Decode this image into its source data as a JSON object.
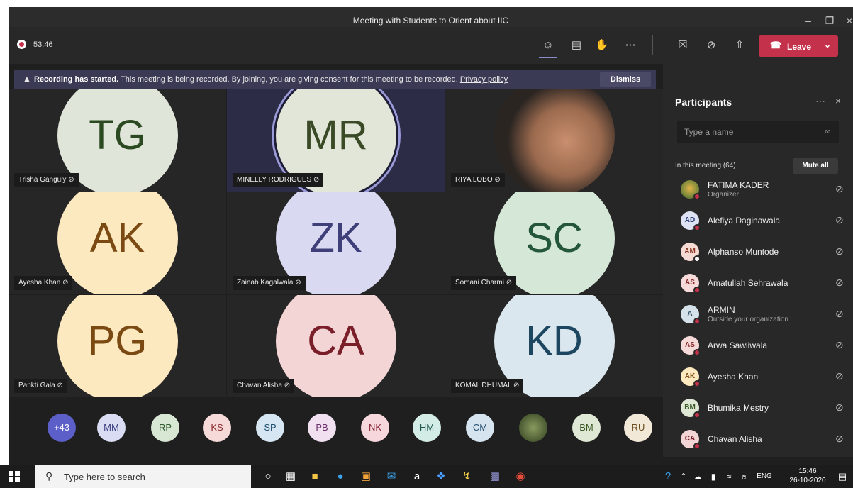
{
  "window": {
    "title": "Meeting with Students to Orient about IIC",
    "minimize": "–",
    "maximize": "❐",
    "close": "×"
  },
  "toolbar": {
    "timer": "53:46",
    "leave_label": "Leave"
  },
  "banner": {
    "bold": "Recording has started.",
    "text": "This meeting is being recorded. By joining, you are giving consent for this meeting to be recorded.",
    "link": "Privacy policy",
    "dismiss": "Dismiss"
  },
  "tiles": [
    {
      "initials": "TG",
      "name": "Trisha Ganguly",
      "bg": "#dfe6d9",
      "fg": "#2c4a22"
    },
    {
      "initials": "MR",
      "name": "MINELLY RODRIGUES",
      "bg": "#e1e6d8",
      "fg": "#3b4a26"
    },
    {
      "initials": "",
      "name": "RIYA LOBO",
      "bg": "#3d3735",
      "fg": "#ffffff"
    },
    {
      "initials": "AK",
      "name": "Ayesha Khan",
      "bg": "#fde9c0",
      "fg": "#7a4a12"
    },
    {
      "initials": "ZK",
      "name": "Zainab Kagalwala",
      "bg": "#d9d9f1",
      "fg": "#3f3f7a"
    },
    {
      "initials": "SC",
      "name": "Somani Charmi",
      "bg": "#d5e8d8",
      "fg": "#24563a"
    },
    {
      "initials": "PG",
      "name": "Pankti Gala",
      "bg": "#fde9c0",
      "fg": "#7a4a12"
    },
    {
      "initials": "CA",
      "name": "Chavan Alisha",
      "bg": "#f3d5d5",
      "fg": "#7a1e2a"
    },
    {
      "initials": "KD",
      "name": "KOMAL DHUMAL",
      "bg": "#dbe7ef",
      "fg": "#1d4760"
    }
  ],
  "strip": [
    {
      "label": "+43",
      "bg": "#5b5fc7",
      "fg": "#ffffff"
    },
    {
      "label": "MM",
      "bg": "#d9dcf2",
      "fg": "#3b3f82"
    },
    {
      "label": "RP",
      "bg": "#d8e7d4",
      "fg": "#2c5a2a"
    },
    {
      "label": "KS",
      "bg": "#f6d9d9",
      "fg": "#8a2a2a"
    },
    {
      "label": "SP",
      "bg": "#d6e6f2",
      "fg": "#1e4d70"
    },
    {
      "label": "PB",
      "bg": "#f0e0f0",
      "fg": "#6a2f6a"
    },
    {
      "label": "NK",
      "bg": "#f6d7dc",
      "fg": "#8a2435"
    },
    {
      "label": "HM",
      "bg": "#d3ece6",
      "fg": "#1f5a4c"
    },
    {
      "label": "CM",
      "bg": "#d6e4ef",
      "fg": "#264e6e"
    },
    {
      "label": "",
      "bg": "#6d7a52",
      "fg": "#ffffff"
    },
    {
      "label": "BM",
      "bg": "#dfe8d4",
      "fg": "#3b5a26"
    },
    {
      "label": "RU",
      "bg": "#f2e8d8",
      "fg": "#6a4b1c"
    }
  ],
  "panel": {
    "title": "Participants",
    "search_placeholder": "Type a name",
    "in_meeting": "In this meeting (64)",
    "mute_all": "Mute all",
    "participants": [
      {
        "initials": "",
        "name": "FATIMA KADER",
        "sub": "Organizer",
        "bg": "#6a7a3a",
        "fg": "#ffffff",
        "badge": "red"
      },
      {
        "initials": "AD",
        "name": "Alefiya Daginawala",
        "sub": "",
        "bg": "#dde3f3",
        "fg": "#2b3d7a",
        "badge": "red"
      },
      {
        "initials": "AM",
        "name": "Alphanso Muntode",
        "sub": "",
        "bg": "#f6dbd4",
        "fg": "#8a3320",
        "badge": "gray"
      },
      {
        "initials": "AS",
        "name": "Amatullah Sehrawala",
        "sub": "",
        "bg": "#f6d9d9",
        "fg": "#8a2a2a",
        "badge": "red"
      },
      {
        "initials": "A",
        "name": "ARMIN",
        "sub": "Outside your organization",
        "bg": "#d6e2ea",
        "fg": "#2a4a5e",
        "badge": "red"
      },
      {
        "initials": "AS",
        "name": "Arwa Sawliwala",
        "sub": "",
        "bg": "#f6d9d9",
        "fg": "#8a2a2a",
        "badge": "red"
      },
      {
        "initials": "AK",
        "name": "Ayesha Khan",
        "sub": "",
        "bg": "#fde9c0",
        "fg": "#7a4a12",
        "badge": "red"
      },
      {
        "initials": "BM",
        "name": "Bhumika Mestry",
        "sub": "",
        "bg": "#dfe8d4",
        "fg": "#3b5a26",
        "badge": "red"
      },
      {
        "initials": "CA",
        "name": "Chavan Alisha",
        "sub": "",
        "bg": "#f3d5d5",
        "fg": "#7a1e2a",
        "badge": "red"
      }
    ]
  },
  "taskbar": {
    "search_text": "Type here to search",
    "lang": "ENG",
    "time": "15:46",
    "date": "26-10-2020"
  }
}
